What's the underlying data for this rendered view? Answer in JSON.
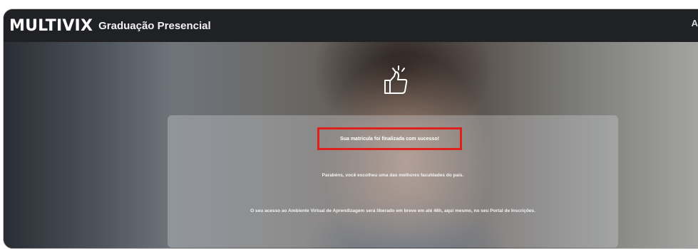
{
  "header": {
    "brand": "MULTIVIX",
    "product": "Graduação Presencial",
    "corner_mark": "A"
  },
  "hero": {
    "icon": "thumbs-up-icon",
    "headline": "Sua matrícula foi finalizada com sucesso!",
    "congrats": "Parabéns, você escolheu uma das melhores faculdades do país.",
    "info": "O seu acesso ao Ambiente Virtual de Aprendizagem será liberado em breve em até 48h, aqui mesmo, no seu Portal de Inscrições."
  },
  "colors": {
    "header_bg": "#1f2125",
    "highlight_border": "#e0201d",
    "text": "#ffffff"
  }
}
